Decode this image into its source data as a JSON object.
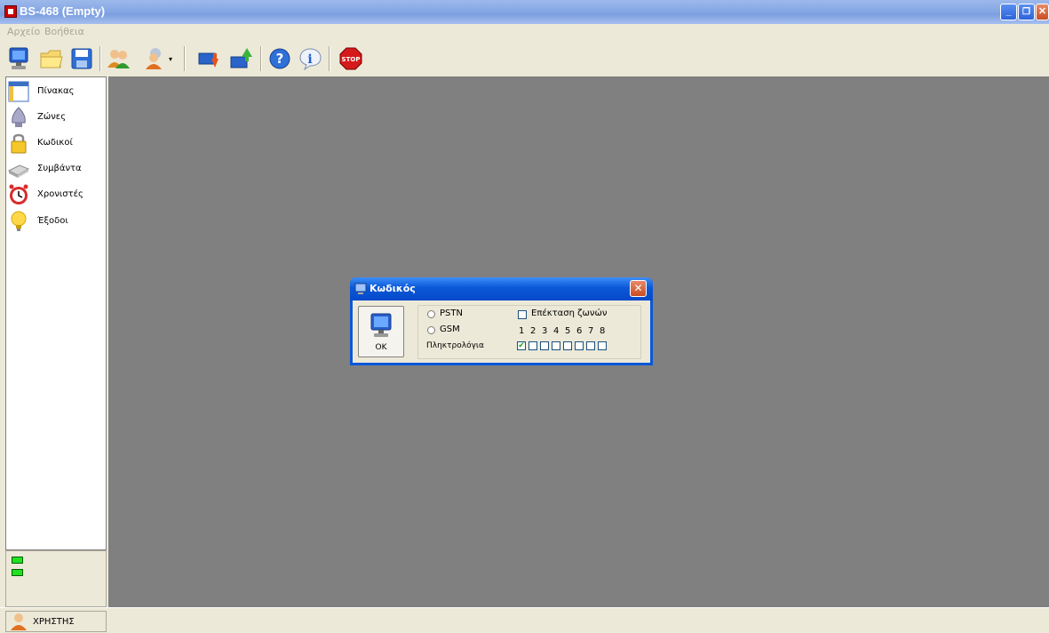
{
  "window": {
    "title": "BS-468 (Empty)",
    "minimize": "_",
    "restore": "❐",
    "close": "✕"
  },
  "menu": {
    "items": [
      "Αρχείο",
      "Βοήθεια"
    ]
  },
  "toolbar": {
    "buttons": [
      {
        "icon": "computer-icon"
      },
      {
        "icon": "folder-open-icon"
      },
      {
        "icon": "save-icon"
      },
      {
        "icon": "users-icon"
      },
      {
        "icon": "user-dropdown-icon"
      },
      {
        "icon": "download-icon"
      },
      {
        "icon": "upload-icon"
      },
      {
        "icon": "help-icon"
      },
      {
        "icon": "info-icon"
      },
      {
        "icon": "stop-icon",
        "label": "STOP"
      }
    ]
  },
  "sidebar": {
    "items": [
      {
        "label": "Πίνακας",
        "icon": "table-icon"
      },
      {
        "label": "Ζώνες",
        "icon": "zone-sensor-icon"
      },
      {
        "label": "Κωδικοί",
        "icon": "lock-icon"
      },
      {
        "label": "Συμβάντα",
        "icon": "events-icon"
      },
      {
        "label": "Χρονιστές",
        "icon": "alarm-clock-icon"
      },
      {
        "label": "Έξοδοι",
        "icon": "lightbulb-icon"
      }
    ]
  },
  "status": {
    "leds": [
      "#22e022",
      "#22e022"
    ],
    "user_label": "ΧΡΗΣΤΗΣ"
  },
  "dialog": {
    "title": "Κωδικός",
    "ok_label": "OK",
    "radio_pstn": "PSTN",
    "radio_gsm": "GSM",
    "keypads_label": "Πληκτρολόγια",
    "zone_extension_label": "Επέκταση ζωνών",
    "keypad_numbers": [
      "1",
      "2",
      "3",
      "4",
      "5",
      "6",
      "7",
      "8"
    ],
    "keypad_checked": [
      true,
      false,
      false,
      false,
      false,
      false,
      false,
      false
    ],
    "zone_extension_checked": false,
    "check_mark": "✔"
  },
  "colors": {
    "main_background": "#808080",
    "dialog_title": "#0a58d8",
    "led": "#22e022"
  }
}
